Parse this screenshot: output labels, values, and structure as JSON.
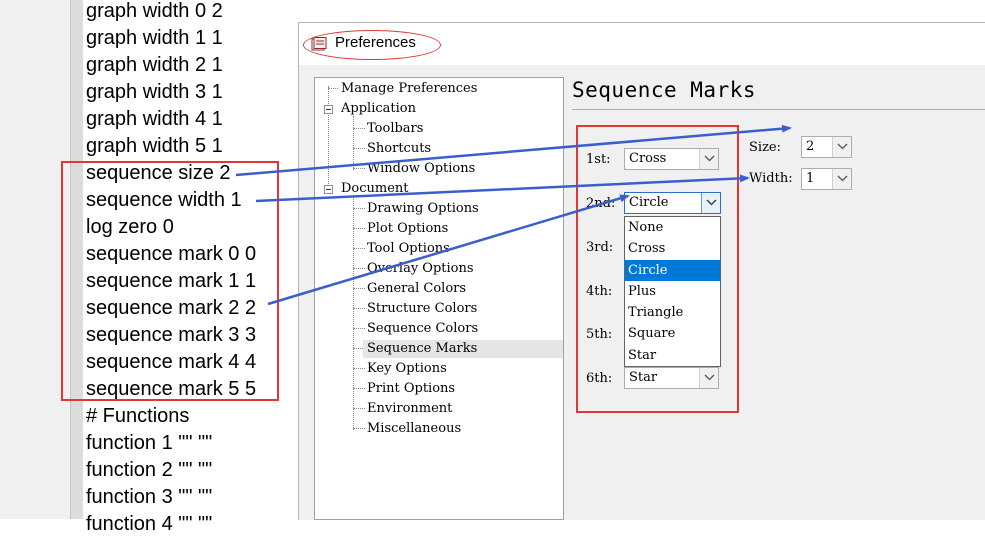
{
  "text_file": {
    "lines": [
      "graph width 0 2",
      "graph width 1 1",
      "graph width 2 1",
      "graph width 3 1",
      "graph width 4 1",
      "graph width 5 1",
      "sequence size 2",
      "sequence width 1",
      "log zero 0",
      "sequence mark 0 0",
      "sequence mark 1 1",
      "sequence mark 2 2",
      "sequence mark 3 3",
      "sequence mark 4 4",
      "sequence mark 5 5",
      "# Functions",
      "function 1 \"\" \"\"",
      "function 2 \"\" \"\"",
      "function 3 \"\" \"\"",
      "function 4 \"\" \"\""
    ]
  },
  "window": {
    "title": "Preferences",
    "icon": "preferences-window-icon"
  },
  "tree": {
    "items": [
      {
        "label": "Manage Preferences"
      },
      {
        "label": "Application"
      },
      {
        "label": "Toolbars"
      },
      {
        "label": "Shortcuts"
      },
      {
        "label": "Window Options"
      },
      {
        "label": "Document"
      },
      {
        "label": "Drawing Options"
      },
      {
        "label": "Plot Options"
      },
      {
        "label": "Tool Options"
      },
      {
        "label": "Overlay Options"
      },
      {
        "label": "General Colors"
      },
      {
        "label": "Structure Colors"
      },
      {
        "label": "Sequence Colors"
      },
      {
        "label": "Sequence Marks"
      },
      {
        "label": "Key Options"
      },
      {
        "label": "Print Options"
      },
      {
        "label": "Environment"
      },
      {
        "label": "Miscellaneous"
      }
    ],
    "selected": "Sequence Marks"
  },
  "section": {
    "title": "Sequence Marks",
    "marks": [
      {
        "label": "1st:",
        "value": "Cross"
      },
      {
        "label": "2nd:",
        "value": "Circle"
      },
      {
        "label": "3rd:",
        "value": ""
      },
      {
        "label": "4th:",
        "value": ""
      },
      {
        "label": "5th:",
        "value": ""
      },
      {
        "label": "6th:",
        "value": "Star"
      }
    ],
    "size": {
      "label": "Size:",
      "value": "2"
    },
    "width": {
      "label": "Width:",
      "value": "1"
    },
    "dropdown": {
      "options": [
        "None",
        "Cross",
        "Circle",
        "Plus",
        "Triangle",
        "Square",
        "Star"
      ],
      "selected": "Circle"
    }
  },
  "colors": {
    "highlight": "#e53535",
    "arrow": "#3a5fcd",
    "selection": "#0078d7"
  }
}
